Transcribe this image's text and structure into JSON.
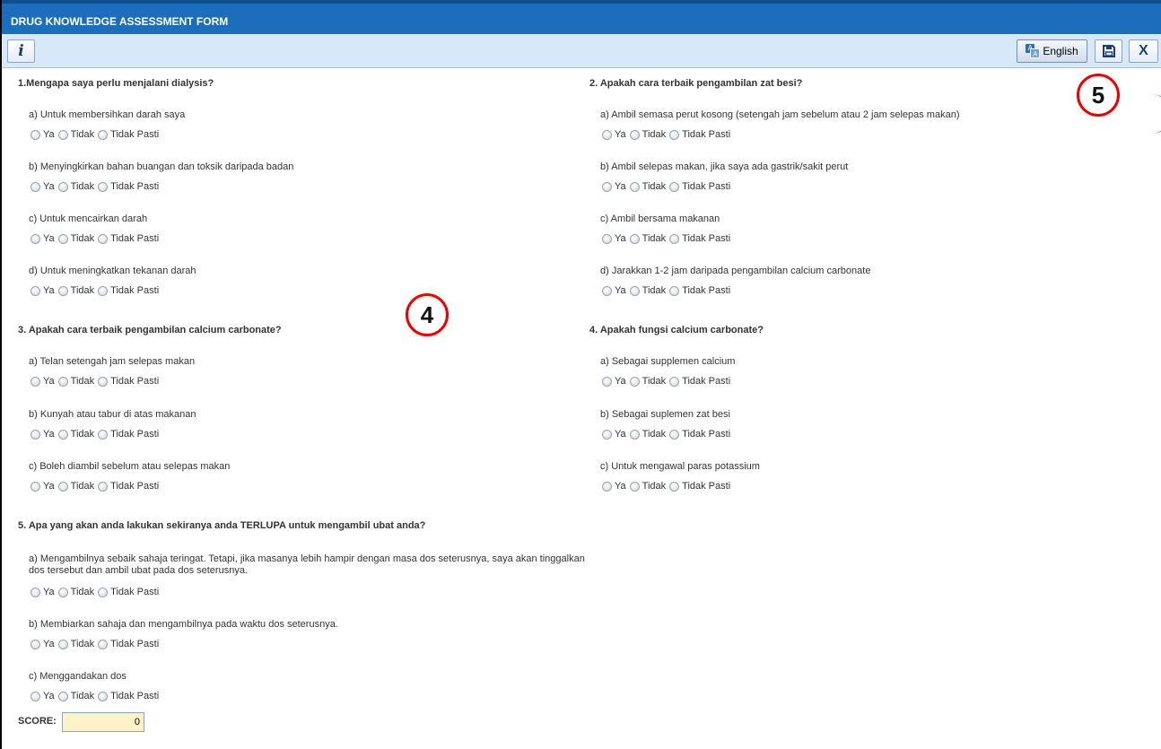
{
  "window": {
    "title": "DRUG KNOWLEDGE ASSESSMENT FORM"
  },
  "toolbar": {
    "info_icon": "i",
    "language_label": "English",
    "language_icon": "translate-icon",
    "save_icon": "floppy-disk-icon",
    "close_label": "X"
  },
  "annotations": {
    "a5": "5",
    "a4": "4"
  },
  "radio_labels": [
    "Ya",
    "Tidak",
    "Tidak Pasti"
  ],
  "questions": [
    {
      "title": "1.Mengapa saya perlu menjalani dialysis?",
      "options": [
        "a) Untuk membersihkan darah saya",
        "b) Menyingkirkan bahan buangan dan toksik daripada badan",
        "c) Untuk mencairkan darah",
        "d) Untuk meningkatkan tekanan darah"
      ]
    },
    {
      "title": "2. Apakah cara terbaik pengambilan zat besi?",
      "options": [
        "a) Ambil semasa perut kosong (setengah jam sebelum atau 2 jam selepas makan)",
        "b) Ambil selepas makan, jika saya ada gastrik/sakit perut",
        "c) Ambil bersama makanan",
        "d) Jarakkan 1-2 jam daripada pengambilan calcium carbonate"
      ]
    },
    {
      "title": "3. Apakah cara terbaik pengambilan calcium carbonate?",
      "options": [
        "a) Telan setengah jam selepas makan",
        "b) Kunyah atau tabur di atas makanan",
        "c) Boleh diambil sebelum atau selepas makan"
      ]
    },
    {
      "title": "4. Apakah fungsi calcium carbonate?",
      "options": [
        "a) Sebagai supplemen calcium",
        "b) Sebagai suplemen zat besi",
        "c) Untuk mengawal paras potassium"
      ]
    },
    {
      "title": "5. Apa yang akan anda lakukan sekiranya anda TERLUPA untuk mengambil ubat anda?",
      "options": [
        "a) Mengambilnya sebaik sahaja teringat. Tetapi, jika masanya lebih hampir dengan masa dos seterusnya, saya akan tinggalkan dos tersebut dan ambil ubat pada dos seterusnya.",
        "b) Membiarkan sahaja dan mengambilnya pada waktu dos seterusnya.",
        "c) Menggandakan dos"
      ]
    }
  ],
  "score": {
    "label": "SCORE:",
    "value": "0"
  }
}
